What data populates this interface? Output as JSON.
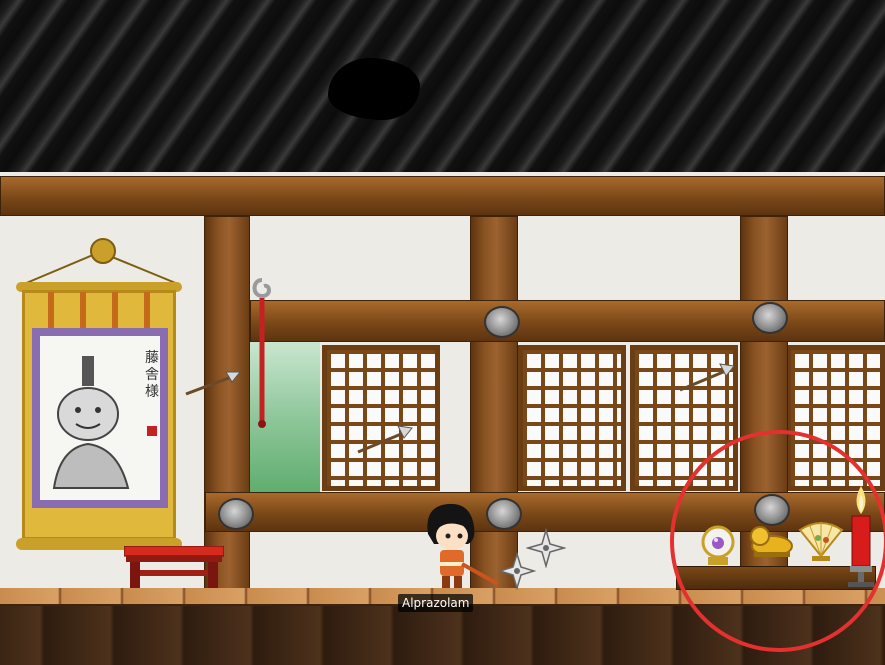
{
  "player": {
    "name": "Alprazolam"
  },
  "scroll": {
    "calligraphy": "藤舎様"
  },
  "annotation": {
    "shape": "circle",
    "color": "#e53030"
  },
  "colors": {
    "wood": "#7a4818",
    "wall": "#ecebe6",
    "roof": "#1d1d1d",
    "scroll_gold": "#e0b83b",
    "scroll_purple": "#8a6db0"
  },
  "icons": [
    "shuriken-icon",
    "arrow-icon",
    "crystal-ball-icon",
    "gold-tiger-icon",
    "paper-fan-icon",
    "candle-icon"
  ]
}
